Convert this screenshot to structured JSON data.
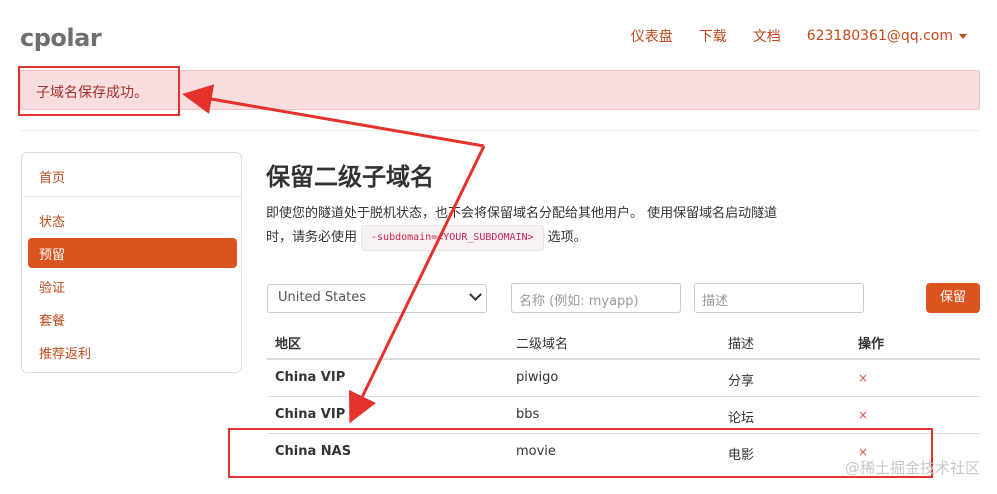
{
  "brand": {
    "logo": "cpolar"
  },
  "nav": {
    "dashboard": "仪表盘",
    "download": "下载",
    "docs": "文档",
    "account": "623180361@qq.com"
  },
  "alert": {
    "message": "子域名保存成功。"
  },
  "sidebar": {
    "items": [
      {
        "label": "首页"
      },
      {
        "label": "状态"
      },
      {
        "label": "预留",
        "active": true
      },
      {
        "label": "验证"
      },
      {
        "label": "套餐"
      },
      {
        "label": "推荐返利"
      }
    ]
  },
  "main": {
    "title": "保留二级子域名",
    "desc_part1": "即使您的隧道处于脱机状态，也不会将保留域名分配给其他用户。 使用保留域名启动隧道",
    "desc_part2": "时，请务必使用",
    "code": "-subdomain=<YOUR_SUBDOMAIN>",
    "desc_part3": "选项。"
  },
  "form": {
    "region_selected": "United States",
    "name_placeholder": "名称 (例如: myapp)",
    "desc_placeholder": "描述",
    "submit_label": "保留"
  },
  "table": {
    "headers": [
      "地区",
      "二级域名",
      "描述",
      "操作"
    ],
    "rows": [
      {
        "region": "China VIP",
        "subdomain": "piwigo",
        "description": "分享",
        "action": "×"
      },
      {
        "region": "China VIP",
        "subdomain": "bbs",
        "description": "论坛",
        "action": "×"
      },
      {
        "region": "China NAS",
        "subdomain": "movie",
        "description": "电影",
        "action": "×"
      }
    ]
  },
  "watermark": "@稀土掘金技术社区",
  "colors": {
    "accent": "#d9541e",
    "link": "#c14a1c",
    "annotation": "#e5322d",
    "alert_bg": "#f8dedf"
  }
}
